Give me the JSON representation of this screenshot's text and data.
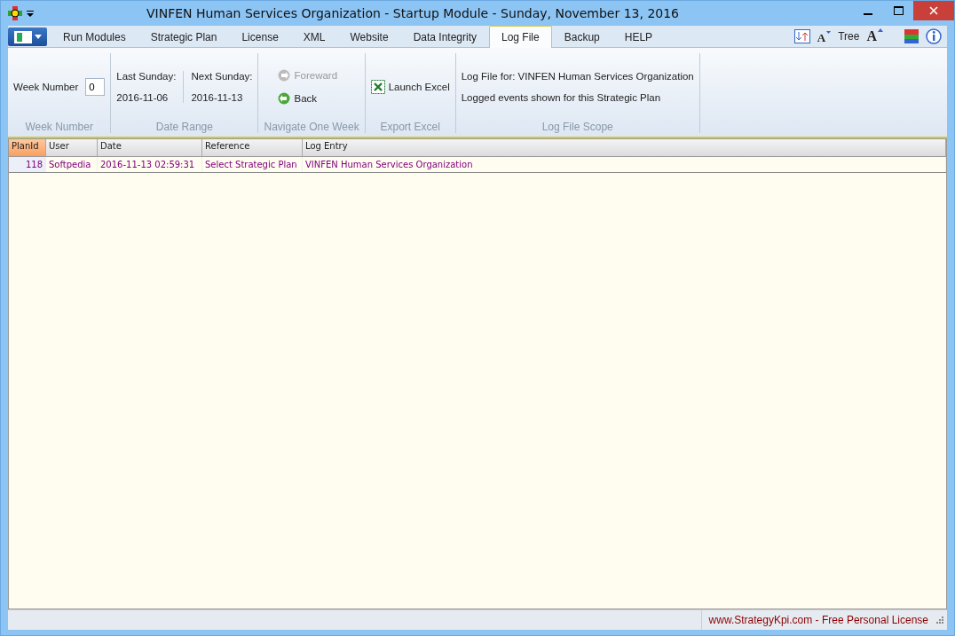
{
  "window": {
    "title": "VINFEN Human Services Organization  - Startup Module - Sunday, November 13, 2016"
  },
  "tabs": [
    {
      "label": "Run Modules",
      "selected": false
    },
    {
      "label": "Strategic Plan",
      "selected": false
    },
    {
      "label": "License",
      "selected": false
    },
    {
      "label": "XML",
      "selected": false
    },
    {
      "label": "Website",
      "selected": false
    },
    {
      "label": "Data Integrity",
      "selected": false
    },
    {
      "label": "Log File",
      "selected": true
    },
    {
      "label": "Backup",
      "selected": false
    },
    {
      "label": "HELP",
      "selected": false
    }
  ],
  "toolbar_right": {
    "smaller_font_glyph": "A",
    "tree_label": "Tree",
    "larger_font_glyph": "A"
  },
  "ribbon": {
    "week_number": {
      "label": "Week Number",
      "value": "0",
      "group": "Week Number"
    },
    "date_range": {
      "last_label": "Last Sunday:",
      "last_value": "2016-11-06",
      "next_label": "Next Sunday:",
      "next_value": "2016-11-13",
      "group": "Date Range"
    },
    "navigate": {
      "buttons": [
        {
          "label": "Foreward",
          "disabled": true,
          "kind": "forward"
        },
        {
          "label": "Back",
          "disabled": false,
          "kind": "back"
        }
      ],
      "group": "Navigate One Week"
    },
    "export": {
      "button": "Launch Excel",
      "group": "Export Excel"
    },
    "scope": {
      "line_1": "Log File for: VINFEN Human Services Organization",
      "line_2": "Logged events shown for this Strategic Plan",
      "group": "Log File Scope"
    }
  },
  "table": {
    "columns": [
      {
        "label": "PlanId",
        "sorted": true
      },
      {
        "label": "User",
        "sorted": false
      },
      {
        "label": "Date",
        "sorted": false
      },
      {
        "label": "Reference",
        "sorted": false
      },
      {
        "label": "Log Entry",
        "sorted": false
      }
    ],
    "rows": [
      [
        "118",
        "Softpedia",
        "2016-11-13 02:59:31",
        "Select Strategic Plan",
        "VINFEN Human Services Organization"
      ]
    ]
  },
  "status_bar": {
    "text": "www.StrategyKpi.com - Free Personal License"
  }
}
